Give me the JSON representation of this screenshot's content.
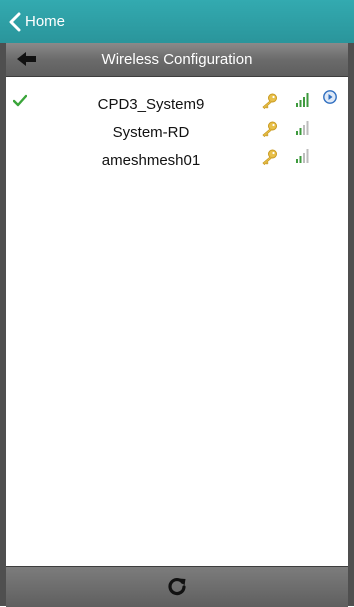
{
  "header": {
    "back_label": "Home"
  },
  "subheader": {
    "title": "Wireless Configuration"
  },
  "networks": [
    {
      "ssid": "CPD3_System9",
      "connected": true,
      "secured": true,
      "signal_bars": 4,
      "has_info": true
    },
    {
      "ssid": "System-RD",
      "connected": false,
      "secured": true,
      "signal_bars": 2,
      "has_info": false
    },
    {
      "ssid": "ameshmesh01",
      "connected": false,
      "secured": true,
      "signal_bars": 2,
      "has_info": false
    }
  ],
  "colors": {
    "topbar": "#2f9fa6",
    "check": "#3aa53a",
    "key": "#e2b43a",
    "signal_on": "#3d9a3d",
    "signal_off": "#bdbdbd",
    "info": "#2f6fc0"
  }
}
